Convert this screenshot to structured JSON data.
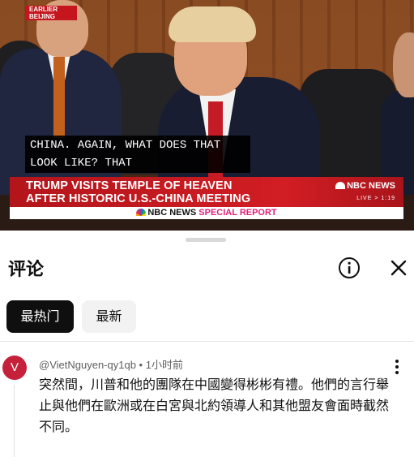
{
  "video": {
    "earlier_badge": [
      "EARLIER",
      "BEIJING"
    ],
    "caption_lines": [
      "CHINA. AGAIN, WHAT DOES THAT",
      "LOOK LIKE? THAT"
    ],
    "headline_lines": [
      "TRUMP VISITS TEMPLE OF HEAVEN",
      "AFTER HISTORIC U.S.-CHINA MEETING"
    ],
    "network_logo": "NBC NEWS",
    "live_label": "LIVE > 1:19",
    "special_report_network": "NBC NEWS",
    "special_report_label": "SPECIAL REPORT",
    "colors": {
      "red": "#c4161c",
      "special_pink": "#e0217a"
    }
  },
  "sheet": {
    "title": "评论",
    "info_icon": "info-icon",
    "close_icon": "close-icon",
    "chips": [
      {
        "label": "最热门",
        "active": true
      },
      {
        "label": "最新",
        "active": false
      }
    ]
  },
  "comments": [
    {
      "avatar_letter": "V",
      "avatar_color": "#c6213b",
      "author": "@VietNguyen-qy1qb",
      "time": "1小时前",
      "text": "突然間，川普和他的團隊在中國變得彬彬有禮。他們的言行舉止與他們在歐洲或在白宮與北約領導人和其他盟友會面時截然不同。"
    }
  ]
}
